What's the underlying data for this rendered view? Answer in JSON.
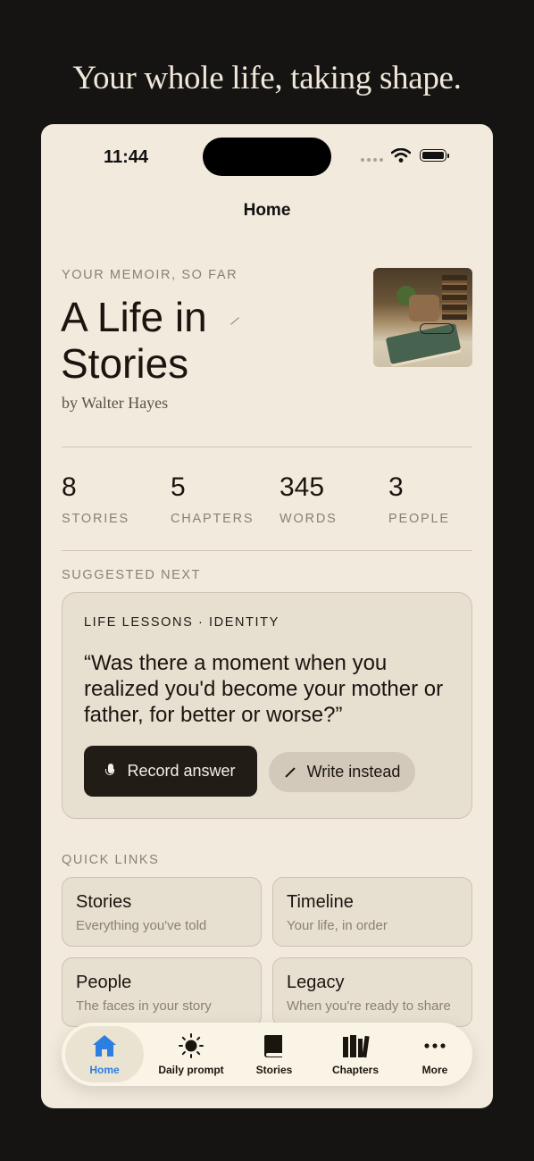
{
  "tagline": "Your whole life, taking shape.",
  "status_bar": {
    "time": "11:44"
  },
  "nav": {
    "title": "Home"
  },
  "memoir": {
    "eyebrow": "YOUR MEMOIR, SO FAR",
    "title": "A Life in Stories",
    "byline": "by Walter Hayes"
  },
  "stats": [
    {
      "value": "8",
      "label": "STORIES"
    },
    {
      "value": "5",
      "label": "CHAPTERS"
    },
    {
      "value": "345",
      "label": "WORDS"
    },
    {
      "value": "3",
      "label": "PEOPLE"
    }
  ],
  "suggested": {
    "heading": "SUGGESTED NEXT",
    "category": "LIFE LESSONS · IDENTITY",
    "question": "“Was there a moment when you realized you'd become your mother or father, for better or worse?”",
    "record_label": "Record answer",
    "write_label": "Write instead"
  },
  "quick_links": {
    "heading": "QUICK LINKS",
    "items": [
      {
        "title": "Stories",
        "subtitle": "Everything you've told"
      },
      {
        "title": "Timeline",
        "subtitle": "Your life, in order"
      },
      {
        "title": "People",
        "subtitle": "The faces in your story"
      },
      {
        "title": "Legacy",
        "subtitle": "When you're ready to share"
      }
    ]
  },
  "tabs": [
    {
      "label": "Home",
      "icon": "house-icon",
      "active": true
    },
    {
      "label": "Daily prompt",
      "icon": "sun-icon",
      "active": false
    },
    {
      "label": "Stories",
      "icon": "book-icon",
      "active": false
    },
    {
      "label": "Chapters",
      "icon": "books-icon",
      "active": false
    },
    {
      "label": "More",
      "icon": "ellipsis-icon",
      "active": false
    }
  ],
  "colors": {
    "accent": "#2a7fe0",
    "background": "#f1eadd",
    "card": "#e7dfd0",
    "dark_button": "#221c17"
  }
}
